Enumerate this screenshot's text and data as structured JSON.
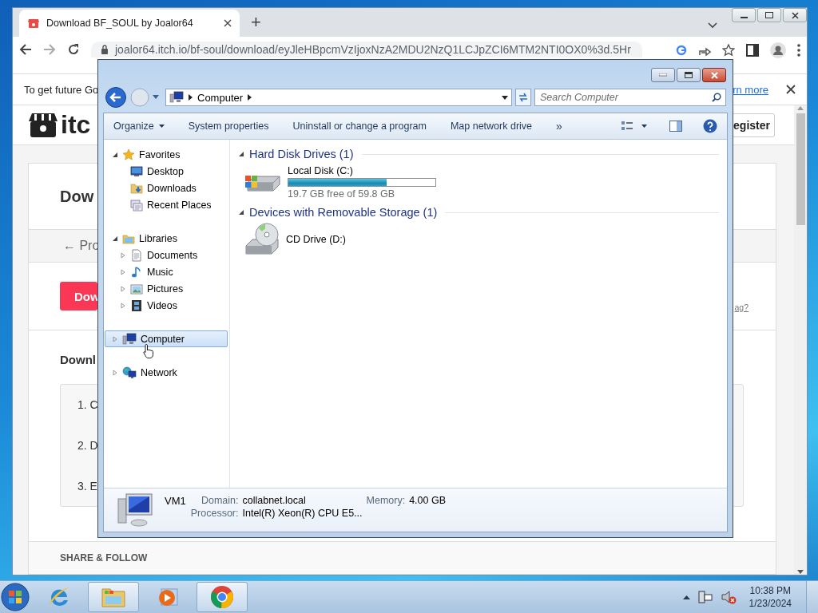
{
  "browser": {
    "tabs": [
      {
        "title": "Download BF_SOUL by Joalor64",
        "selected": true
      }
    ],
    "new_tab_button": "+",
    "url": "joalor64.itch.io/bf-soul/download/eyJleHBpcmVzIjoxNzA2MDU2NzQ1LCJpZCI6MTM2NTI0OX0%3d.5Hr",
    "info_bar": {
      "text": "To get future Go",
      "link": "rn more"
    },
    "page": {
      "logo_text": "itc",
      "register_button": "egister",
      "heading": "Dow",
      "back_link": "← Pro",
      "download_button": "Dow",
      "side_link": "ag?",
      "section_heading": "Downl",
      "steps": [
        "1. C",
        "2. D",
        "3. E"
      ],
      "footer_heading": "SHARE & FOLLOW"
    }
  },
  "explorer": {
    "breadcrumb": [
      "Computer"
    ],
    "search": {
      "placeholder": "Search Computer"
    },
    "toolbar": [
      {
        "label": "Organize",
        "menu": true
      },
      {
        "label": "System properties",
        "menu": false
      },
      {
        "label": "Uninstall or change a program",
        "menu": false
      },
      {
        "label": "Map network drive",
        "menu": false
      }
    ],
    "overflow": "»",
    "nav": [
      {
        "label": "Favorites",
        "expanded": true,
        "selected": false,
        "children": [
          {
            "label": "Desktop",
            "selected": false
          },
          {
            "label": "Downloads",
            "selected": false
          },
          {
            "label": "Recent Places",
            "selected": false
          }
        ]
      },
      {
        "label": "Libraries",
        "expanded": true,
        "selected": false,
        "children": [
          {
            "label": "Documents",
            "expanded": false,
            "selected": false
          },
          {
            "label": "Music",
            "expanded": false,
            "selected": false
          },
          {
            "label": "Pictures",
            "expanded": false,
            "selected": false
          },
          {
            "label": "Videos",
            "expanded": false,
            "selected": false
          }
        ]
      },
      {
        "label": "Computer",
        "expanded": false,
        "selected": true
      },
      {
        "label": "Network",
        "expanded": false,
        "selected": false
      }
    ],
    "groups": [
      {
        "title": "Hard Disk Drives (1)",
        "expanded": true,
        "items": [
          {
            "kind": "disk",
            "name": "Local Disk (C:)",
            "level": 0.67,
            "reading": "19.7 GB free of 59.8 GB"
          }
        ]
      },
      {
        "title": "Devices with Removable Storage (1)",
        "expanded": true,
        "items": [
          {
            "kind": "cd",
            "name": "CD Drive (D:)"
          }
        ]
      }
    ],
    "details": {
      "name": "VM1",
      "fields": [
        {
          "label": "Domain:",
          "value": "collabnet.local"
        },
        {
          "label": "Memory:",
          "value": "4.00 GB"
        },
        {
          "label": "Processor:",
          "value": "Intel(R) Xeon(R) CPU E5..."
        }
      ]
    }
  },
  "taskbar": {
    "apps": [
      {
        "kind": "ie",
        "active": false
      },
      {
        "kind": "explorer",
        "active": true
      },
      {
        "kind": "media",
        "active": false
      },
      {
        "kind": "chrome",
        "active": true
      }
    ],
    "clock": {
      "time": "10:38 PM",
      "date": "1/23/2024"
    }
  }
}
